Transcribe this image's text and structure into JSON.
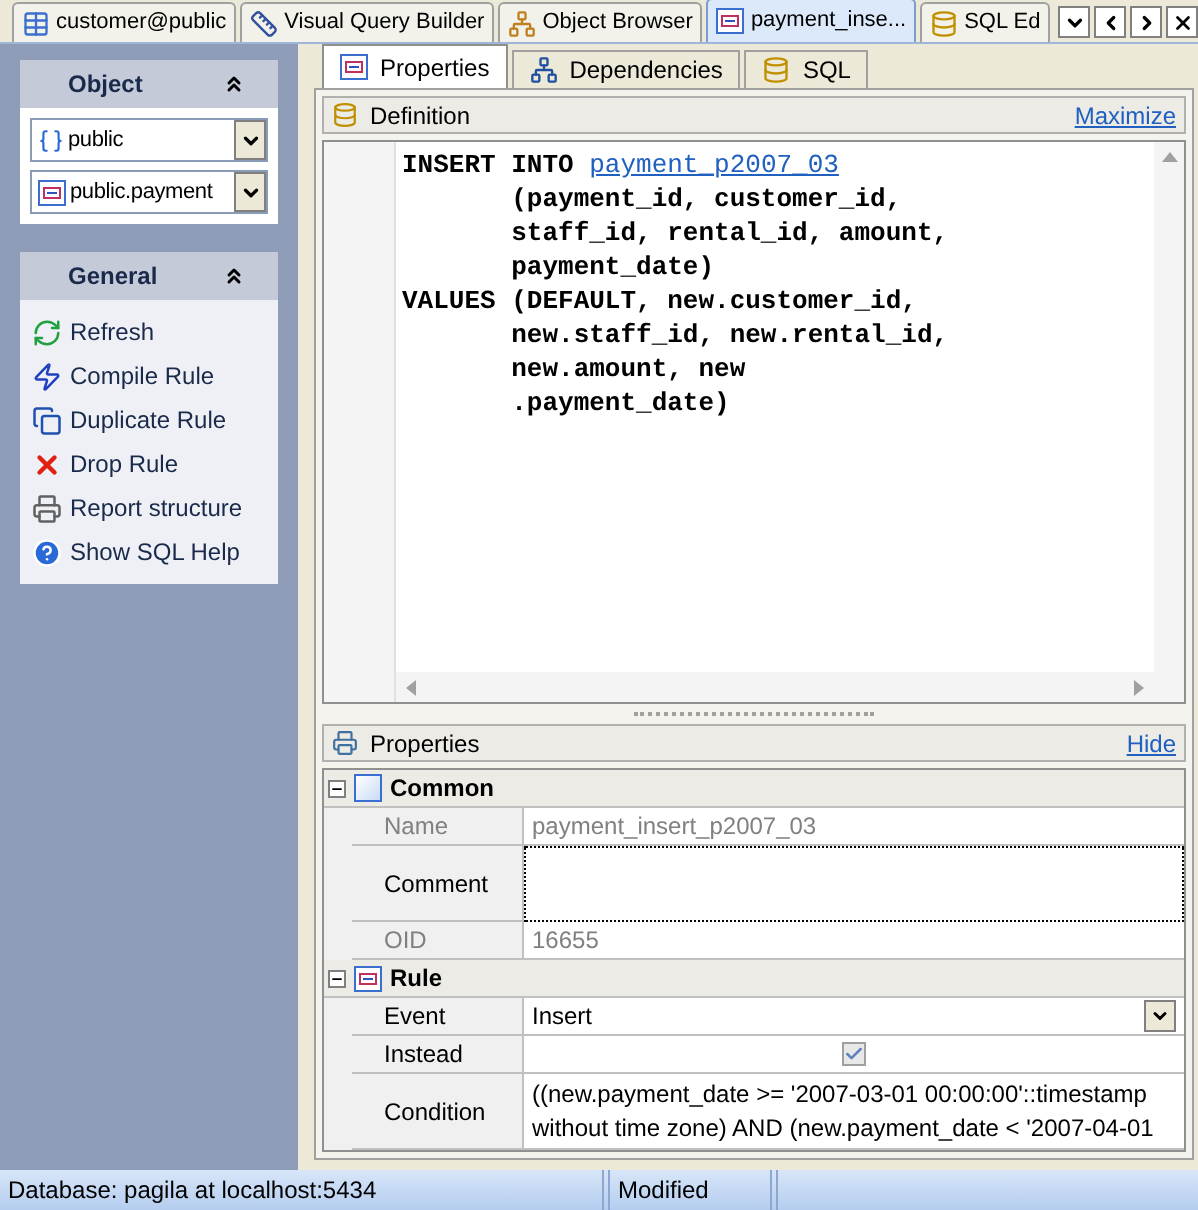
{
  "doc_tabs": [
    {
      "label": "customer@public",
      "selected": false
    },
    {
      "label": "Visual Query Builder",
      "selected": false
    },
    {
      "label": "Object Browser",
      "selected": false
    },
    {
      "label": "payment_inse...",
      "selected": true
    },
    {
      "label": "SQL Ed",
      "selected": false
    }
  ],
  "sidebar": {
    "object_panel": {
      "title": "Object",
      "schema": "public",
      "table": "public.payment"
    },
    "general_panel": {
      "title": "General",
      "items": [
        {
          "label": "Refresh"
        },
        {
          "label": "Compile Rule"
        },
        {
          "label": "Duplicate Rule"
        },
        {
          "label": "Drop Rule"
        },
        {
          "label": "Report structure"
        },
        {
          "label": "Show SQL Help"
        }
      ]
    }
  },
  "sub_tabs": [
    {
      "label": "Properties",
      "selected": true
    },
    {
      "label": "Dependencies",
      "selected": false
    },
    {
      "label": "SQL",
      "selected": false
    }
  ],
  "definition": {
    "title": "Definition",
    "action": "Maximize",
    "lines": [
      {
        "text": "INSERT INTO ",
        "link": "payment_p2007_03"
      },
      {
        "text": "       (payment_id, customer_id,"
      },
      {
        "text": "       staff_id, rental_id, amount,"
      },
      {
        "text": "       payment_date)"
      },
      {
        "text": "VALUES (DEFAULT, new.customer_id,"
      },
      {
        "text": "       new.staff_id, new.rental_id,"
      },
      {
        "text": "       new.amount, new"
      },
      {
        "text": "       .payment_date)"
      }
    ]
  },
  "properties": {
    "title": "Properties",
    "action": "Hide",
    "groups": [
      {
        "title": "Common",
        "expanded": true,
        "rows": [
          {
            "kind": "readonly",
            "label": "Name",
            "value": "payment_insert_p2007_03"
          },
          {
            "kind": "edit",
            "label": "Comment"
          },
          {
            "kind": "readonly",
            "label": "OID",
            "value": "16655"
          }
        ]
      },
      {
        "title": "Rule",
        "expanded": true,
        "rows": [
          {
            "kind": "select",
            "label": "Event",
            "value": "Insert"
          },
          {
            "kind": "checkbox",
            "label": "Instead",
            "checked": true
          },
          {
            "kind": "text",
            "label": "Condition",
            "value": "((new.payment_date >= '2007-03-01 00:00:00'::timestamp without time zone) AND (new.payment_date < '2007-04-01"
          }
        ]
      }
    ]
  },
  "status_bar": {
    "database": "Database: pagila at localhost:5434",
    "state": "Modified"
  }
}
